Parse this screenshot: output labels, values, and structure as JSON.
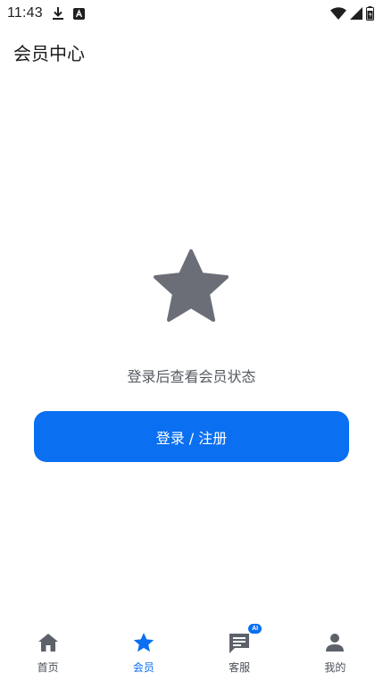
{
  "status_bar": {
    "time": "11:43",
    "icons": [
      "download-icon",
      "a-notification-icon",
      "wifi-icon",
      "signal-icon",
      "battery-icon"
    ]
  },
  "header": {
    "title": "会员中心"
  },
  "main": {
    "icon": "star-icon",
    "prompt": "登录后查看会员状态",
    "login_button_label": "登录 / 注册"
  },
  "colors": {
    "accent": "#0a6ff0",
    "star_gray": "#6b6e77",
    "text_gray": "#555a62"
  },
  "tabs": [
    {
      "label": "首页",
      "icon": "home-icon",
      "active": false
    },
    {
      "label": "会员",
      "icon": "star-icon",
      "active": true
    },
    {
      "label": "客服",
      "icon": "chat-icon",
      "active": false,
      "badge": "AI"
    },
    {
      "label": "我的",
      "icon": "person-icon",
      "active": false
    }
  ]
}
